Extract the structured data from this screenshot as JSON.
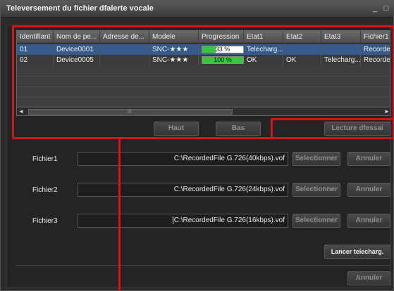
{
  "window": {
    "title": "Televersement du fichier dfalerte vocale",
    "minimize_glyph": "_",
    "maximize_glyph": "□"
  },
  "table": {
    "columns": [
      "Identifiant",
      "Nom de pe...",
      "Adresse de...",
      "Modele",
      "Progression",
      "Etat1",
      "Etat2",
      "Etat3",
      "Fichier1"
    ],
    "rows": [
      {
        "id": "01",
        "name": "Device0001",
        "address": "",
        "model": "SNC-★★★",
        "progress_label": "33 %",
        "progress": 0.33,
        "etat1": "Telecharg...",
        "etat2": "",
        "etat3": "",
        "fichier1": "Recordec"
      },
      {
        "id": "02",
        "name": "Device0005",
        "address": "",
        "model": "SNC-★★★",
        "progress_label": "100 %",
        "progress": 1.0,
        "etat1": "OK",
        "etat2": "OK",
        "etat3": "Telecharg...",
        "fichier1": "Recordec"
      }
    ],
    "scroll_left": "◄",
    "scroll_right": "►",
    "scroll_grip": "III"
  },
  "buttons": {
    "haut": "Haut",
    "bas": "Bas",
    "lecture": "Lecture dfessai",
    "lancer": "Lancer telecharg.",
    "annuler_bottom": "Annuler"
  },
  "files": [
    {
      "label": "Fichier1",
      "path": "C:\\RecordedFile  G.726(40kbps).vof",
      "select": "Selectionner",
      "cancel": "Annuler"
    },
    {
      "label": "Fichier2",
      "path": "C:\\RecordedFile  G.726(24kbps).vof",
      "select": "Selectionner",
      "cancel": "Annuler"
    },
    {
      "label": "Fichier3",
      "path": "C:\\RecordedFile  G.726(16kbps).vof",
      "select": "Selectionner",
      "cancel": "Annuler"
    }
  ],
  "colors": {
    "highlight": "#d0161b",
    "selected_row": "#375a8c",
    "progress_fill": "#3fc23f"
  }
}
